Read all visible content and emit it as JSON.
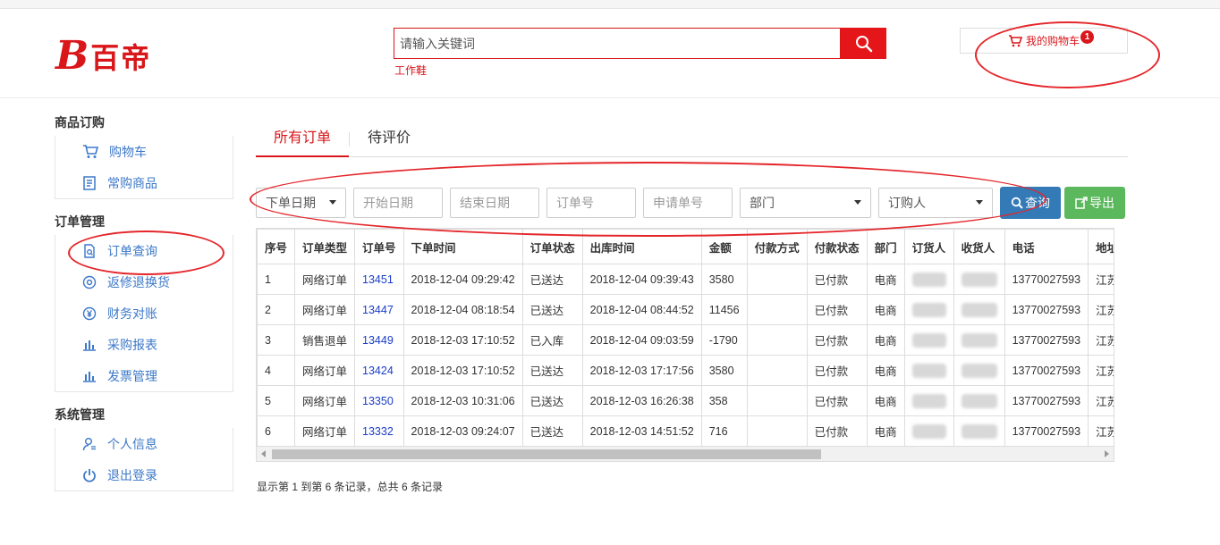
{
  "header": {
    "logo_mark": "B",
    "logo_text": "百帝",
    "search_placeholder": "请输入关键词",
    "hotword": "工作鞋",
    "cart_label": "我的购物车",
    "cart_count": "1"
  },
  "sidebar": {
    "groups": [
      {
        "title": "商品订购",
        "items": [
          {
            "label": "购物车",
            "icon": "cart-icon"
          },
          {
            "label": "常购商品",
            "icon": "list-icon"
          }
        ]
      },
      {
        "title": "订单管理",
        "items": [
          {
            "label": "订单查询",
            "icon": "order-search-icon"
          },
          {
            "label": "返修退换货",
            "icon": "return-icon"
          },
          {
            "label": "财务对账",
            "icon": "yen-icon"
          },
          {
            "label": "采购报表",
            "icon": "bar-chart-icon"
          },
          {
            "label": "发票管理",
            "icon": "bar-chart-icon"
          }
        ]
      },
      {
        "title": "系统管理",
        "items": [
          {
            "label": "个人信息",
            "icon": "user-icon"
          },
          {
            "label": "退出登录",
            "icon": "power-icon"
          }
        ]
      }
    ]
  },
  "tabs": [
    "所有订单",
    "待评价"
  ],
  "filters": {
    "date_type": "下单日期",
    "start_date": "开始日期",
    "end_date": "结束日期",
    "order_no": "订单号",
    "apply_no": "申请单号",
    "department": "部门",
    "orderer": "订购人",
    "query_btn": "查询",
    "export_btn": "导出"
  },
  "table": {
    "columns": [
      "序号",
      "订单类型",
      "订单号",
      "下单时间",
      "订单状态",
      "出库时间",
      "金额",
      "付款方式",
      "付款状态",
      "部门",
      "订货人",
      "收货人",
      "电话",
      "地址"
    ],
    "rows": [
      [
        "1",
        "网络订单",
        "13451",
        "2018-12-04 09:29:42",
        "已送达",
        "2018-12-04 09:39:43",
        "3580",
        "",
        "已付款",
        "电商",
        "",
        "",
        "13770027593",
        "江苏"
      ],
      [
        "2",
        "网络订单",
        "13447",
        "2018-12-04 08:18:54",
        "已送达",
        "2018-12-04 08:44:52",
        "11456",
        "",
        "已付款",
        "电商",
        "",
        "",
        "13770027593",
        "江苏"
      ],
      [
        "3",
        "销售退单",
        "13449",
        "2018-12-03 17:10:52",
        "已入库",
        "2018-12-04 09:03:59",
        "-1790",
        "",
        "已付款",
        "电商",
        "",
        "",
        "13770027593",
        "江苏"
      ],
      [
        "4",
        "网络订单",
        "13424",
        "2018-12-03 17:10:52",
        "已送达",
        "2018-12-03 17:17:56",
        "3580",
        "",
        "已付款",
        "电商",
        "",
        "",
        "13770027593",
        "江苏"
      ],
      [
        "5",
        "网络订单",
        "13350",
        "2018-12-03 10:31:06",
        "已送达",
        "2018-12-03 16:26:38",
        "358",
        "",
        "已付款",
        "电商",
        "",
        "",
        "13770027593",
        "江苏"
      ],
      [
        "6",
        "网络订单",
        "13332",
        "2018-12-03 09:24:07",
        "已送达",
        "2018-12-03 14:51:52",
        "716",
        "",
        "已付款",
        "电商",
        "",
        "",
        "13770027593",
        "江苏"
      ]
    ]
  },
  "pager_info": "显示第 1 到第 6 条记录，总共 6 条记录",
  "colors": {
    "brand_red": "#d9161a",
    "link_blue": "#3c78c8",
    "query_blue": "#337ab7",
    "export_green": "#5cb85c",
    "annotation_red": "#e4262b"
  }
}
